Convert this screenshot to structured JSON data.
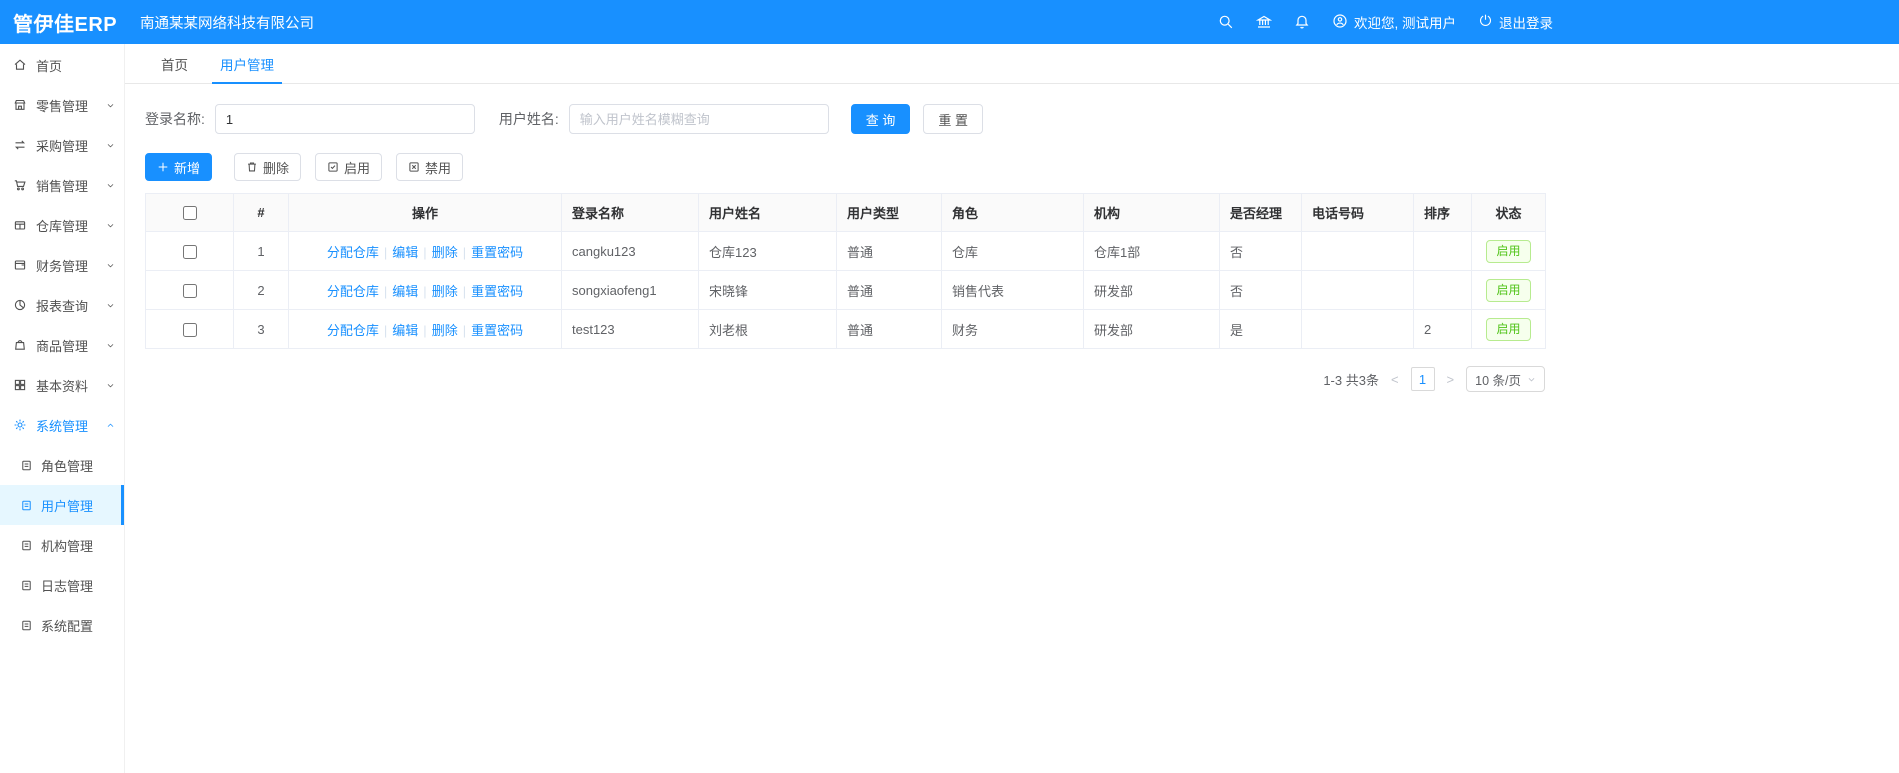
{
  "app": {
    "accent_color": "#1890ff",
    "success_color": "#52c41a"
  },
  "header": {
    "logo": "管伊佳ERP",
    "company": "南通某某网络科技有限公司",
    "welcome": "欢迎您, 测试用户",
    "logout": "退出登录"
  },
  "sidebar": {
    "items": [
      {
        "label": "首页"
      },
      {
        "label": "零售管理"
      },
      {
        "label": "采购管理"
      },
      {
        "label": "销售管理"
      },
      {
        "label": "仓库管理"
      },
      {
        "label": "财务管理"
      },
      {
        "label": "报表查询"
      },
      {
        "label": "商品管理"
      },
      {
        "label": "基本资料"
      },
      {
        "label": "系统管理"
      }
    ],
    "submenu_items": [
      {
        "label": "角色管理"
      },
      {
        "label": "用户管理"
      },
      {
        "label": "机构管理"
      },
      {
        "label": "日志管理"
      },
      {
        "label": "系统配置"
      }
    ]
  },
  "tabs": [
    {
      "label": "首页"
    },
    {
      "label": "用户管理"
    }
  ],
  "filters": {
    "login_name_label": "登录名称:",
    "login_name_value": "1",
    "user_name_label": "用户姓名:",
    "user_name_placeholder": "输入用户姓名模糊查询",
    "search_button": "查 询",
    "reset_button": "重 置"
  },
  "toolbar": {
    "add": "新增",
    "delete": "删除",
    "enable": "启用",
    "disable": "禁用"
  },
  "table": {
    "headers": [
      "#",
      "操作",
      "登录名称",
      "用户姓名",
      "用户类型",
      "角色",
      "机构",
      "是否经理",
      "电话号码",
      "排序",
      "状态"
    ],
    "action_links": [
      "分配仓库",
      "编辑",
      "删除",
      "重置密码"
    ],
    "rows": [
      {
        "index": "1",
        "login": "cangku123",
        "name": "仓库123",
        "type": "普通",
        "role": "仓库",
        "org": "仓库1部",
        "manager": "否",
        "phone": "",
        "sort": "",
        "status": "启用"
      },
      {
        "index": "2",
        "login": "songxiaofeng1",
        "name": "宋晓锋",
        "type": "普通",
        "role": "销售代表",
        "org": "研发部",
        "manager": "否",
        "phone": "",
        "sort": "",
        "status": "启用"
      },
      {
        "index": "3",
        "login": "test123",
        "name": "刘老根",
        "type": "普通",
        "role": "财务",
        "org": "研发部",
        "manager": "是",
        "phone": "",
        "sort": "2",
        "status": "启用"
      }
    ]
  },
  "pagination": {
    "range": "1-3 共3条",
    "prev": "<",
    "current_page": "1",
    "next": ">",
    "page_size": "10 条/页"
  }
}
